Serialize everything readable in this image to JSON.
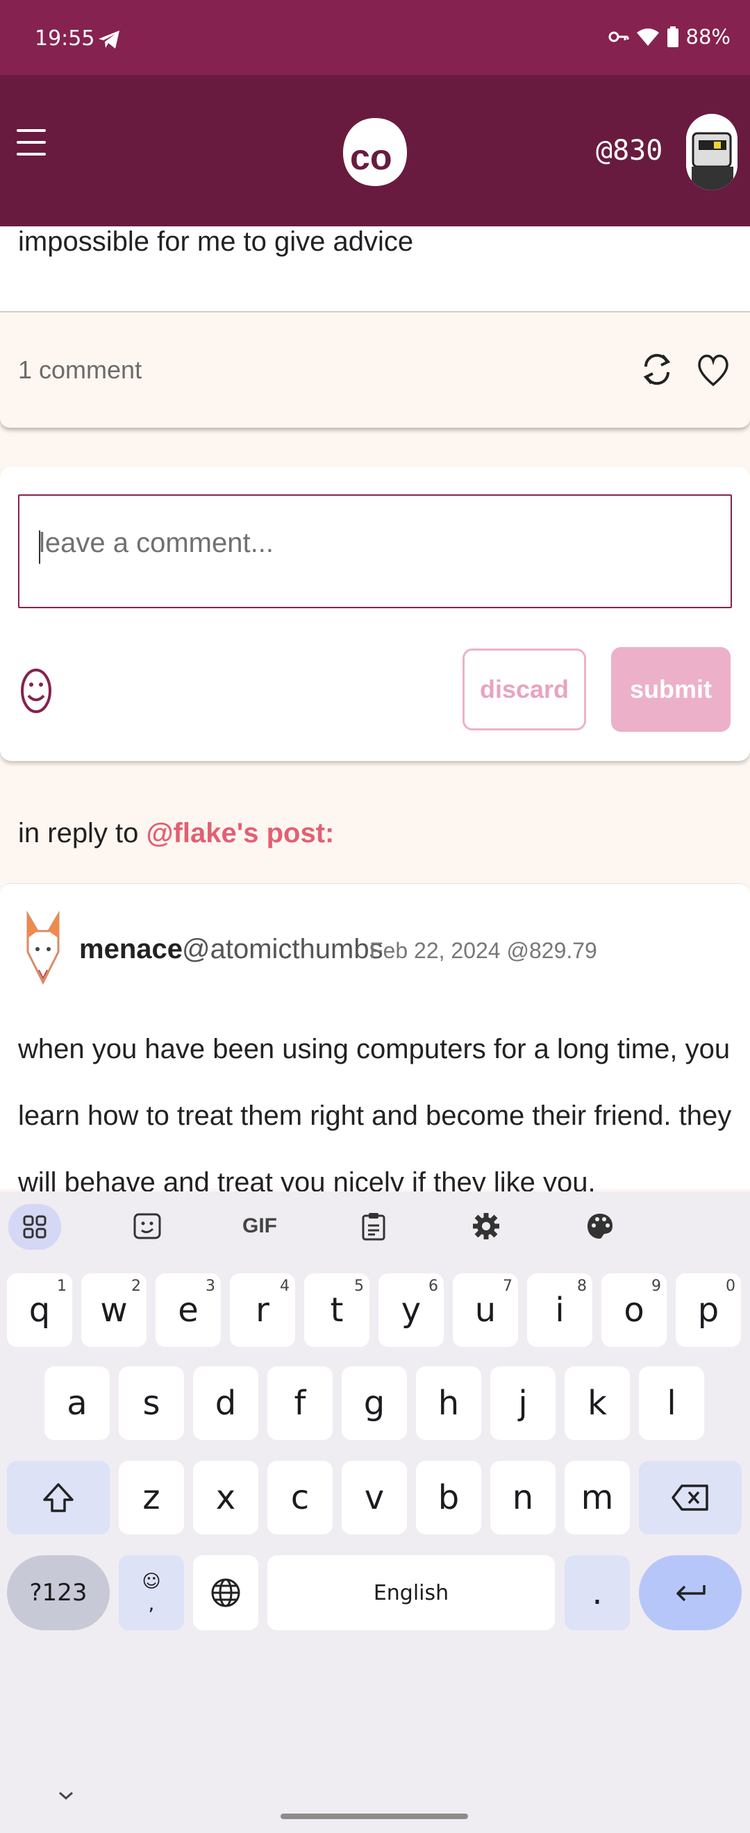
{
  "status_bar": {
    "time": "19:55",
    "battery": "88%"
  },
  "header": {
    "handle": "@830"
  },
  "post": {
    "tail_text": "impossible for me to give advice",
    "comment_count": "1 comment"
  },
  "comment_form": {
    "placeholder": "leave a comment...",
    "discard_label": "discard",
    "submit_label": "submit"
  },
  "reply_context": {
    "prefix": "in reply to",
    "link": "@flake's post:"
  },
  "reply": {
    "display_name": "menace",
    "handle": "@atomicthumbs",
    "date": "Feb 22, 2024 @829.79",
    "body": "when you have been using computers for a long time, you learn how to treat them right and become their friend. they will behave and treat you nicely if they like you."
  },
  "keyboard": {
    "toolbar": [
      "apps-icon",
      "sticker-icon",
      "GIF",
      "clipboard-icon",
      "settings-icon",
      "palette-icon"
    ],
    "row1": [
      [
        "q",
        "1"
      ],
      [
        "w",
        "2"
      ],
      [
        "e",
        "3"
      ],
      [
        "r",
        "4"
      ],
      [
        "t",
        "5"
      ],
      [
        "y",
        "6"
      ],
      [
        "u",
        "7"
      ],
      [
        "i",
        "8"
      ],
      [
        "o",
        "9"
      ],
      [
        "p",
        "0"
      ]
    ],
    "row2": [
      "a",
      "s",
      "d",
      "f",
      "g",
      "h",
      "j",
      "k",
      "l"
    ],
    "row3": [
      "z",
      "x",
      "c",
      "v",
      "b",
      "n",
      "m"
    ],
    "symbols_label": "?123",
    "emoji_comma": ",",
    "space_label": "English",
    "period": "."
  },
  "colors": {
    "status_bar": "#86224f",
    "header": "#691b3f",
    "accent": "#e35f73",
    "button_pink": "#ecb1c8"
  }
}
